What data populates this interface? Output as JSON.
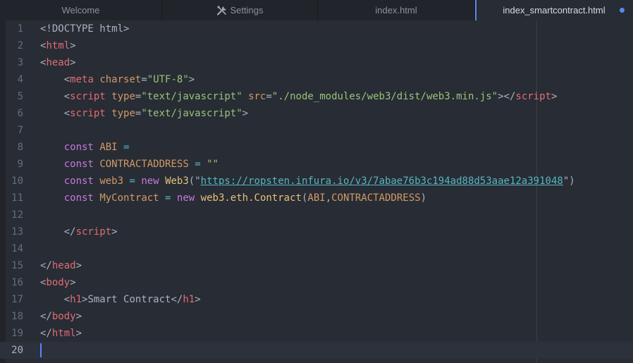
{
  "tabs": [
    {
      "label": "Welcome"
    },
    {
      "label": "Settings",
      "icon": "tools-icon"
    },
    {
      "label": "index.html"
    },
    {
      "label": "index_smartcontract.html",
      "modified": true
    }
  ],
  "colors": {
    "accent": "#568af2",
    "tag": "#e06c75",
    "attribute": "#d19a66",
    "string": "#98c379",
    "keyword": "#c678dd",
    "class": "#e5c07b",
    "link": "#56b6c2"
  },
  "editor": {
    "current_line": 20,
    "line_numbers": [
      "1",
      "2",
      "3",
      "4",
      "5",
      "6",
      "7",
      "8",
      "9",
      "10",
      "11",
      "12",
      "13",
      "14",
      "15",
      "16",
      "17",
      "18",
      "19",
      "20"
    ],
    "lines": [
      [
        [
          "punc",
          "<!DOCTYPE html>"
        ]
      ],
      [
        [
          "punc",
          "<"
        ],
        [
          "tag",
          "html"
        ],
        [
          "punc",
          ">"
        ]
      ],
      [
        [
          "punc",
          "<"
        ],
        [
          "tag",
          "head"
        ],
        [
          "punc",
          ">"
        ]
      ],
      [
        [
          "txt",
          "    "
        ],
        [
          "punc",
          "<"
        ],
        [
          "tag",
          "meta"
        ],
        [
          "txt",
          " "
        ],
        [
          "attr",
          "charset"
        ],
        [
          "punc",
          "="
        ],
        [
          "str",
          "\"UTF-8\""
        ],
        [
          "punc",
          ">"
        ]
      ],
      [
        [
          "txt",
          "    "
        ],
        [
          "punc",
          "<"
        ],
        [
          "tag",
          "script"
        ],
        [
          "txt",
          " "
        ],
        [
          "attr",
          "type"
        ],
        [
          "punc",
          "="
        ],
        [
          "str",
          "\"text/javascript\""
        ],
        [
          "txt",
          " "
        ],
        [
          "attr",
          "src"
        ],
        [
          "punc",
          "="
        ],
        [
          "str",
          "\"./node_modules/web3/dist/web3.min.js\""
        ],
        [
          "punc",
          "></"
        ],
        [
          "tag",
          "script"
        ],
        [
          "punc",
          ">"
        ]
      ],
      [
        [
          "txt",
          "    "
        ],
        [
          "punc",
          "<"
        ],
        [
          "tag",
          "script"
        ],
        [
          "txt",
          " "
        ],
        [
          "attr",
          "type"
        ],
        [
          "punc",
          "="
        ],
        [
          "str",
          "\"text/javascript\""
        ],
        [
          "punc",
          ">"
        ]
      ],
      [],
      [
        [
          "txt",
          "    "
        ],
        [
          "kw",
          "const"
        ],
        [
          "txt",
          " "
        ],
        [
          "var",
          "ABI"
        ],
        [
          "txt",
          " "
        ],
        [
          "op",
          "="
        ]
      ],
      [
        [
          "txt",
          "    "
        ],
        [
          "kw",
          "const"
        ],
        [
          "txt",
          " "
        ],
        [
          "var",
          "CONTRACTADDRESS"
        ],
        [
          "txt",
          " "
        ],
        [
          "op",
          "="
        ],
        [
          "txt",
          " "
        ],
        [
          "str",
          "\"\""
        ]
      ],
      [
        [
          "txt",
          "    "
        ],
        [
          "kw",
          "const"
        ],
        [
          "txt",
          " "
        ],
        [
          "var",
          "web3"
        ],
        [
          "txt",
          " "
        ],
        [
          "op",
          "="
        ],
        [
          "txt",
          " "
        ],
        [
          "kw",
          "new"
        ],
        [
          "txt",
          " "
        ],
        [
          "cls",
          "Web3"
        ],
        [
          "punc",
          "(\""
        ],
        [
          "url",
          "https://ropsten.infura.io/v3/7abae76b3c194ad88d53aae12a391048"
        ],
        [
          "punc",
          "\")"
        ]
      ],
      [
        [
          "txt",
          "    "
        ],
        [
          "kw",
          "const"
        ],
        [
          "txt",
          " "
        ],
        [
          "var",
          "MyContract"
        ],
        [
          "txt",
          " "
        ],
        [
          "op",
          "="
        ],
        [
          "txt",
          " "
        ],
        [
          "kw",
          "new"
        ],
        [
          "txt",
          " "
        ],
        [
          "cls",
          "web3.eth.Contract"
        ],
        [
          "punc",
          "("
        ],
        [
          "var",
          "ABI"
        ],
        [
          "punc",
          ","
        ],
        [
          "var",
          "CONTRACTADDRESS"
        ],
        [
          "punc",
          ")"
        ]
      ],
      [],
      [
        [
          "txt",
          "    "
        ],
        [
          "punc",
          "</"
        ],
        [
          "tag",
          "script"
        ],
        [
          "punc",
          ">"
        ]
      ],
      [],
      [
        [
          "punc",
          "</"
        ],
        [
          "tag",
          "head"
        ],
        [
          "punc",
          ">"
        ]
      ],
      [
        [
          "punc",
          "<"
        ],
        [
          "tag",
          "body"
        ],
        [
          "punc",
          ">"
        ]
      ],
      [
        [
          "txt",
          "    "
        ],
        [
          "punc",
          "<"
        ],
        [
          "tag",
          "h1"
        ],
        [
          "punc",
          ">"
        ],
        [
          "txt",
          "Smart Contract"
        ],
        [
          "punc",
          "</"
        ],
        [
          "tag",
          "h1"
        ],
        [
          "punc",
          ">"
        ]
      ],
      [
        [
          "punc",
          "</"
        ],
        [
          "tag",
          "body"
        ],
        [
          "punc",
          ">"
        ]
      ],
      [
        [
          "punc",
          "</"
        ],
        [
          "tag",
          "html"
        ],
        [
          "punc",
          ">"
        ]
      ],
      []
    ]
  }
}
